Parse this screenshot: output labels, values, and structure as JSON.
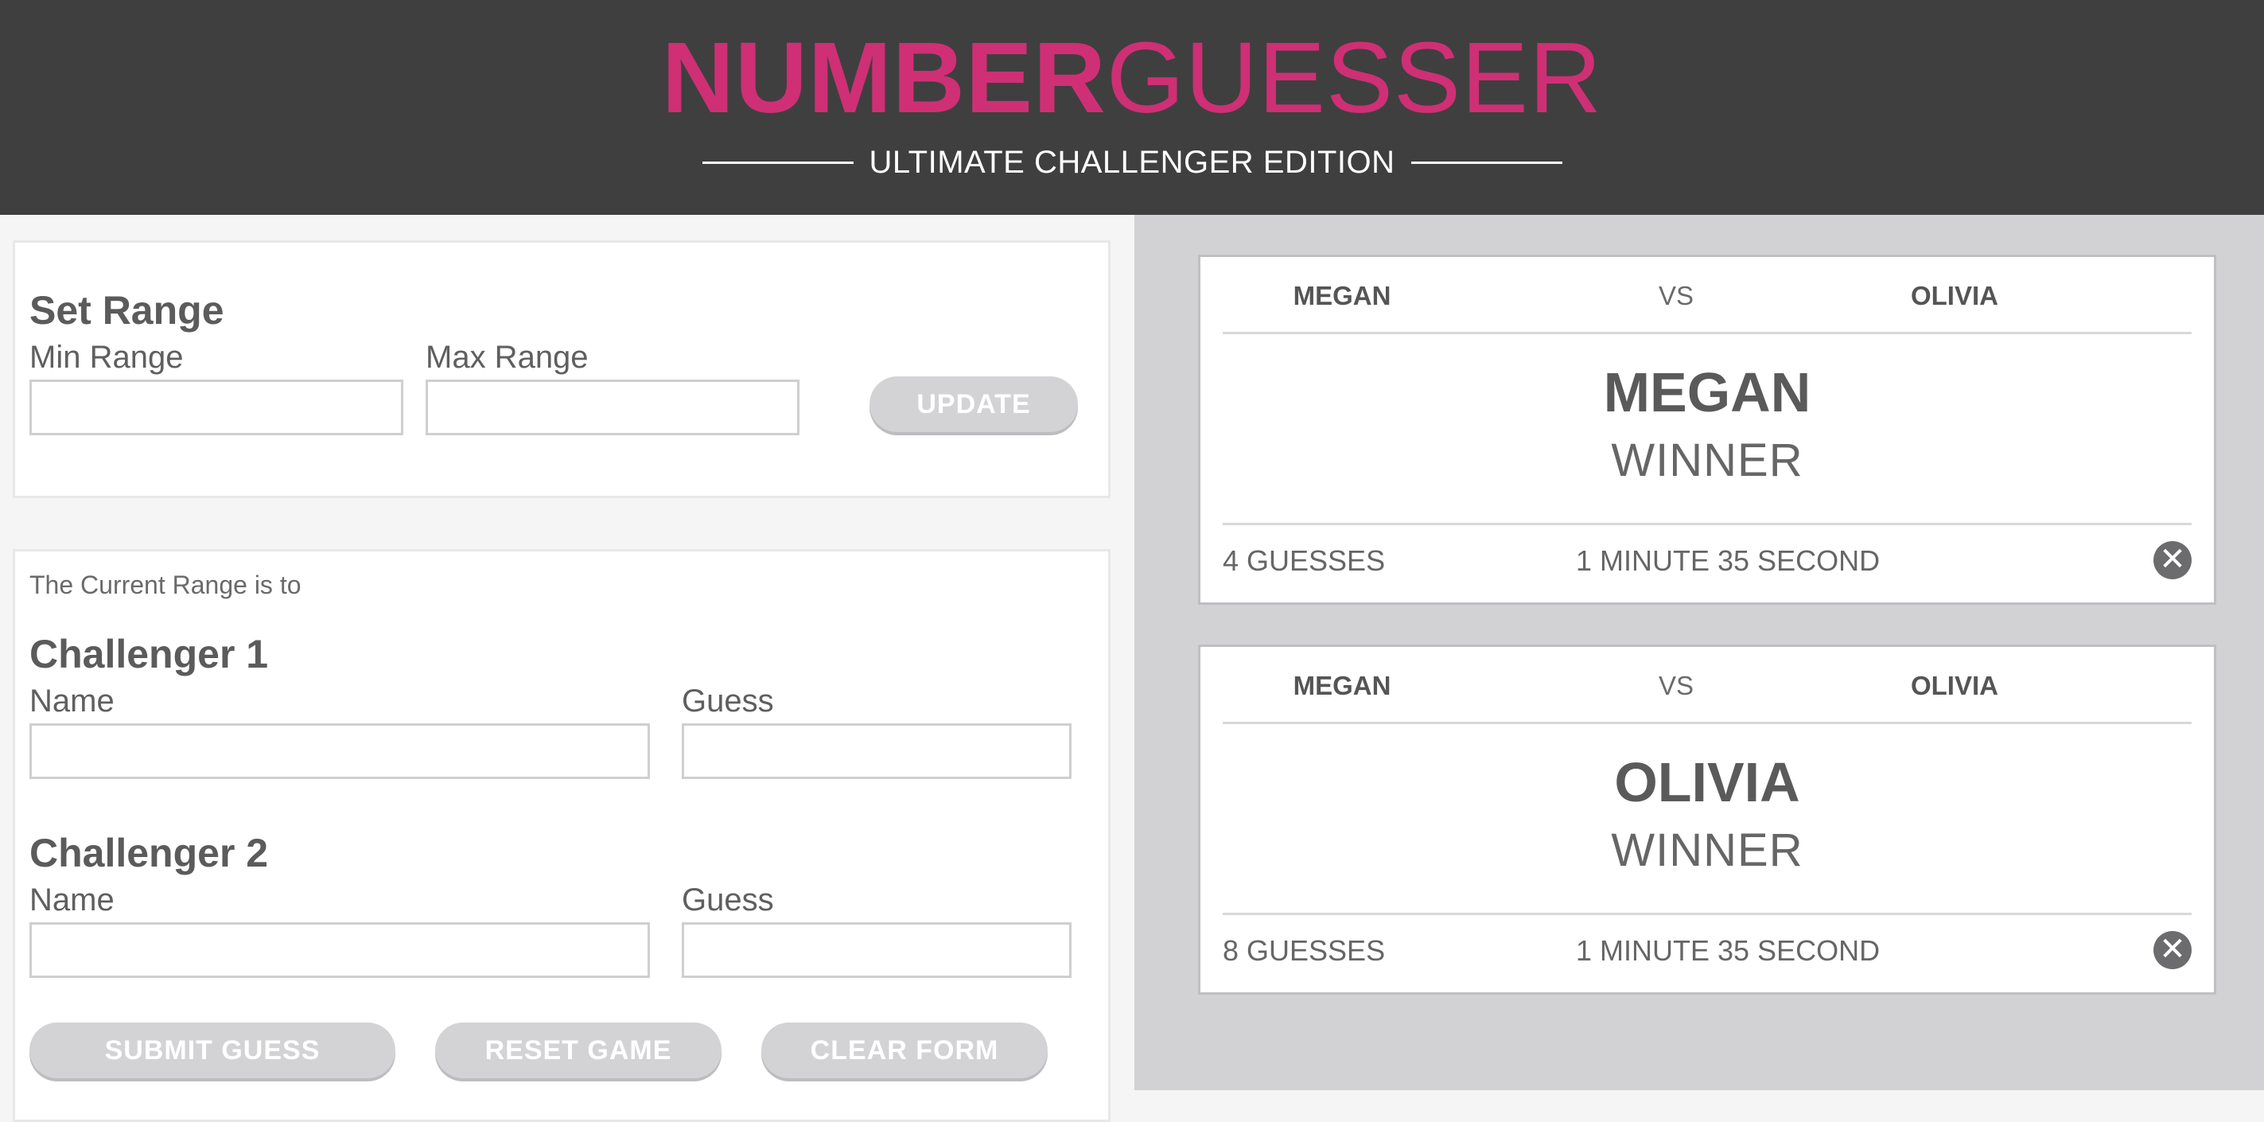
{
  "header": {
    "title_bold": "NUMBER",
    "title_light": "GUESSER",
    "subtitle": "ULTIMATE CHALLENGER EDITION",
    "brand_color": "#cf2f75",
    "background": "#3f3f40"
  },
  "range_form": {
    "title": "Set Range",
    "min_label": "Min Range",
    "max_label": "Max Range",
    "min_value": "",
    "max_value": "",
    "update_label": "UPDATE"
  },
  "challenge_form": {
    "range_status": "The Current Range is  to",
    "challenger1": {
      "title": "Challenger 1",
      "name_label": "Name",
      "guess_label": "Guess",
      "name_value": "",
      "guess_value": ""
    },
    "challenger2": {
      "title": "Challenger 2",
      "name_label": "Name",
      "guess_label": "Guess",
      "name_value": "",
      "guess_value": ""
    },
    "submit_label": "SUBMIT GUESS",
    "reset_label": "RESET GAME",
    "clear_label": "CLEAR FORM"
  },
  "results": [
    {
      "player1": "MEGAN",
      "vs": "VS",
      "player2": "OLIVIA",
      "winner": "MEGAN",
      "winner_label": "WINNER",
      "guesses": "4 GUESSES",
      "time": "1 MINUTE 35 SECOND",
      "close_icon": "close-icon"
    },
    {
      "player1": "MEGAN",
      "vs": "VS",
      "player2": "OLIVIA",
      "winner": "OLIVIA",
      "winner_label": "WINNER",
      "guesses": "8 GUESSES",
      "time": "1 MINUTE 35 SECOND",
      "close_icon": "close-icon"
    }
  ]
}
